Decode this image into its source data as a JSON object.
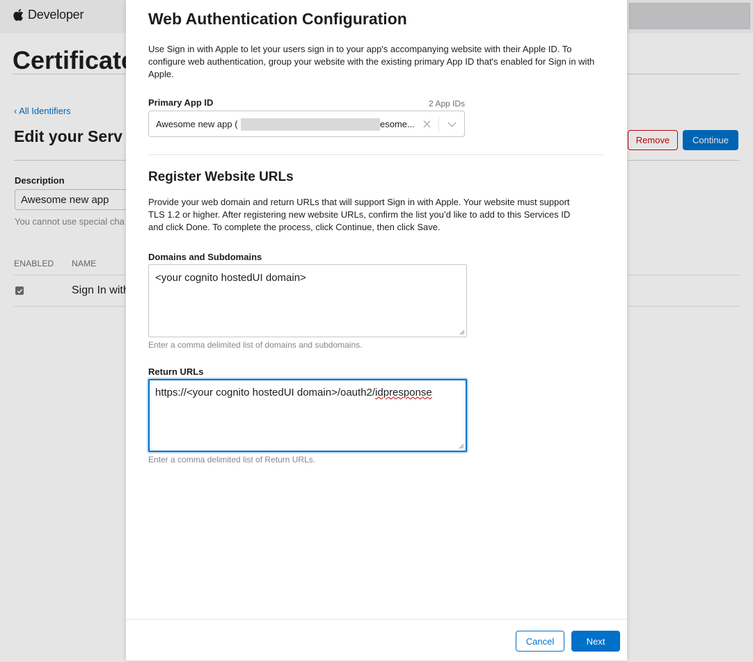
{
  "header": {
    "brand": "Developer",
    "brand_icon": "apple-logo-icon"
  },
  "page": {
    "title": "Certificate",
    "back_link": "‹ All Identifiers",
    "section_title": "Edit your Serv",
    "remove_label": "Remove",
    "continue_label": "Continue",
    "description_label": "Description",
    "description_value": "Awesome new app",
    "description_help": "You cannot use special cha",
    "table": {
      "col_enabled": "ENABLED",
      "col_name": "NAME",
      "rows": [
        {
          "enabled": true,
          "name": "Sign In with"
        }
      ]
    }
  },
  "modal": {
    "title": "Web Authentication Configuration",
    "intro": "Use Sign in with Apple to let your users sign in to your app's accompanying website with their Apple ID. To configure web authentication, group your website with the existing primary App ID that's enabled for Sign in with Apple.",
    "primary_app_id": {
      "label": "Primary App ID",
      "count": "2 App IDs",
      "value_prefix": "Awesome new app (",
      "value_suffix": "esome...",
      "clear_icon": "close-icon",
      "dropdown_icon": "chevron-down-icon"
    },
    "register": {
      "title": "Register Website URLs",
      "intro": "Provide your web domain and return URLs that will support Sign in with Apple. Your website must support TLS 1.2 or higher. After registering new website URLs, confirm the list you’d like to add to this Services ID and click Done. To complete the process, click Continue, then click Save.",
      "domains": {
        "label": "Domains and Subdomains",
        "value": "<your cognito hostedUI domain>",
        "help": "Enter a comma delimited list of domains and subdomains."
      },
      "return_urls": {
        "label": "Return URLs",
        "value_prefix": "https://<your cognito hostedUI domain>/oauth2/",
        "value_misspelled": "idpresponse",
        "help": "Enter a comma delimited list of Return URLs."
      }
    },
    "footer": {
      "cancel_label": "Cancel",
      "next_label": "Next"
    }
  },
  "colors": {
    "accent": "#0070c9",
    "danger": "#d30505",
    "text": "#1d1d1f",
    "muted": "#86868b"
  }
}
